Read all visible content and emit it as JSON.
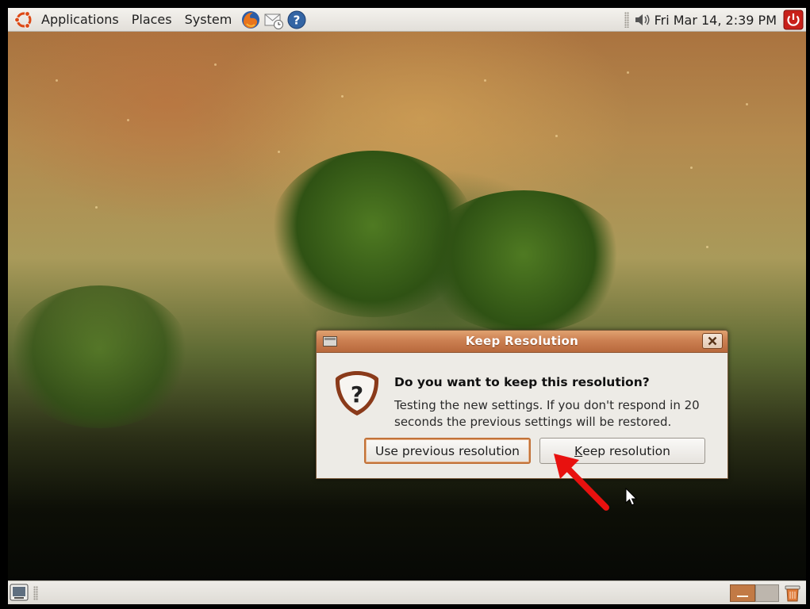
{
  "top_panel": {
    "menus": [
      "Applications",
      "Places",
      "System"
    ],
    "launchers": [
      "firefox-icon",
      "mail-icon",
      "help-icon"
    ],
    "clock": "Fri Mar 14,  2:39 PM",
    "icons": [
      "volume-icon",
      "power-icon"
    ]
  },
  "dialog": {
    "title": "Keep Resolution",
    "heading": "Do you want to keep this resolution?",
    "message": "Testing the new settings. If you don't respond in 20 seconds the previous settings will be restored.",
    "buttons": {
      "use_previous": "Use previous resolution",
      "keep_mnemonic": "K",
      "keep_rest": "eep resolution"
    }
  },
  "bottom_panel": {
    "icons": [
      "show-desktop-icon",
      "workspace-switcher",
      "trash-icon"
    ]
  },
  "colors": {
    "titlebar": "#cc8052",
    "panel": "#e2dfd9",
    "annotation_arrow": "#e8110f",
    "focus_ring": "#c27238"
  }
}
